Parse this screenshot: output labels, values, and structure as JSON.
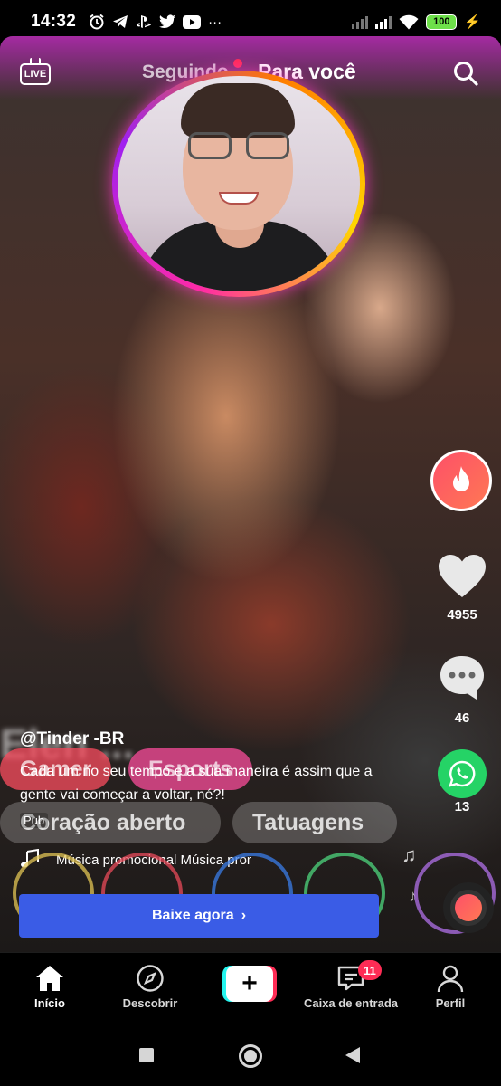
{
  "status_bar": {
    "time": "14:32",
    "battery": "100",
    "left_icons": [
      "alarm-icon",
      "telegram-icon",
      "playstation-icon",
      "twitter-icon",
      "youtube-icon",
      "more-dots-icon"
    ],
    "more": "···"
  },
  "header": {
    "live_label": "LIVE",
    "tab_following": "Seguindo",
    "tab_for_you": "Para você",
    "accent_color": "#ff2b55"
  },
  "video": {
    "blurred_text": "Elen ..."
  },
  "actions": {
    "likes": "4955",
    "comments": "46",
    "shares": "13"
  },
  "post": {
    "username": "@Tinder -BR",
    "caption": "Cada um no seu tempo e a sua maneira é assim que a gente vai começar a voltar, né?!",
    "pub_label": "Pub",
    "music": "Música promocional Música promocional",
    "background_pills": [
      "Gamer",
      "Esports",
      "Coração aberto",
      "Tatuagens"
    ]
  },
  "cta": {
    "label": "Baixe agora",
    "arrow": "›",
    "color": "#3a5ce6"
  },
  "bottom_nav": {
    "home": "Início",
    "discover": "Descobrir",
    "create": "+",
    "inbox": "Caixa de entrada",
    "inbox_badge": "11",
    "profile": "Perfil"
  }
}
